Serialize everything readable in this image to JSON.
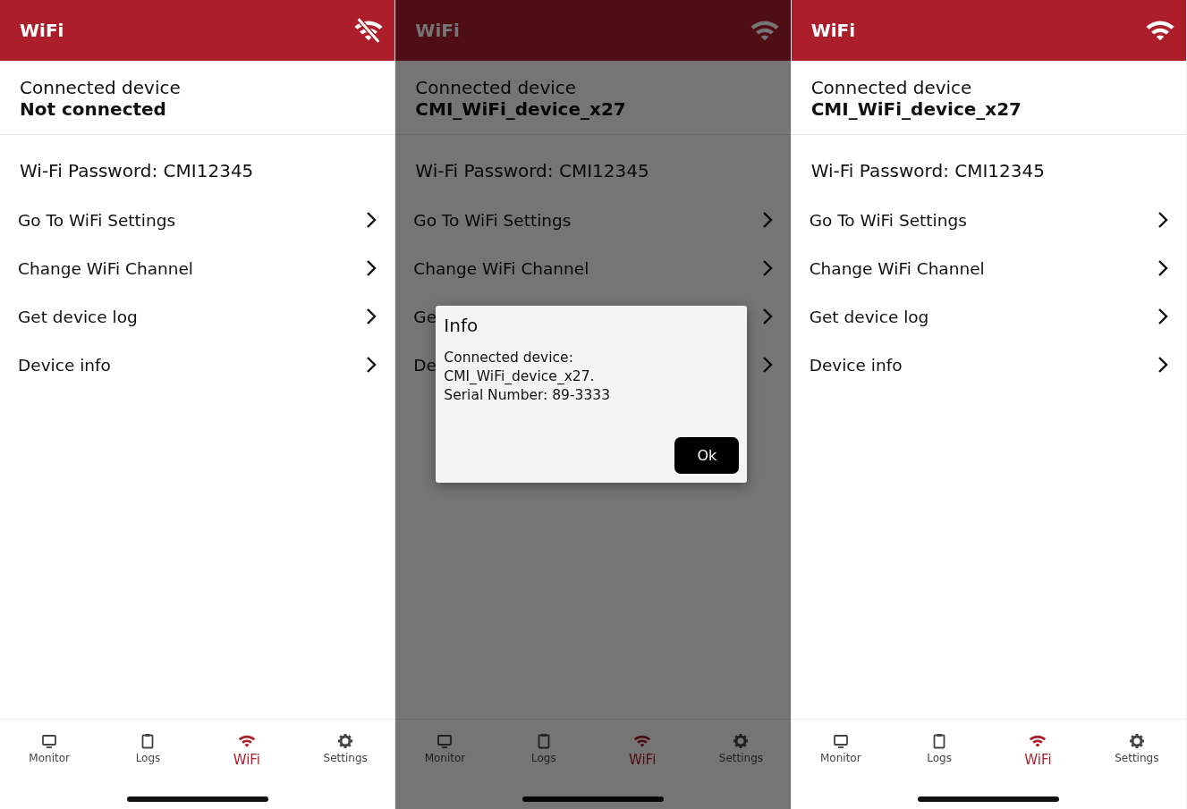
{
  "screens": [
    {
      "title": "WiFi",
      "wifi_connected": false,
      "dimmed": false,
      "connected_label": "Connected device",
      "connected_value": "Not connected",
      "password": "Wi-Fi Password: CMI12345",
      "items": [
        "Go To WiFi Settings",
        "Change WiFi Channel",
        "Get device log",
        "Device info"
      ],
      "tabs": [
        {
          "label": "Monitor",
          "selected": false
        },
        {
          "label": "Logs",
          "selected": false
        },
        {
          "label": "WiFi",
          "selected": true
        },
        {
          "label": "Settings",
          "selected": false
        }
      ]
    },
    {
      "title": "WiFi",
      "wifi_connected": true,
      "dimmed": true,
      "connected_label": "Connected device",
      "connected_value": "CMI_WiFi_device_x27",
      "password": "Wi-Fi Password: CMI12345",
      "items": [
        "Go To WiFi Settings",
        "Change WiFi Channel",
        "Ge",
        "De"
      ],
      "tabs": [
        {
          "label": "Monitor",
          "selected": false
        },
        {
          "label": "Logs",
          "selected": false
        },
        {
          "label": "WiFi",
          "selected": true
        },
        {
          "label": "Settings",
          "selected": false
        }
      ],
      "dialog": {
        "title": "Info",
        "lines": [
          "Connected device:",
          "CMI_WiFi_device_x27.",
          "Serial Number: 89-3333"
        ],
        "button": "Ok"
      }
    },
    {
      "title": "WiFi",
      "wifi_connected": true,
      "dimmed": false,
      "connected_label": "Connected device",
      "connected_value": "CMI_WiFi_device_x27",
      "password": "Wi-Fi Password: CMI12345",
      "items": [
        "Go To WiFi Settings",
        "Change WiFi Channel",
        "Get device log",
        "Device info"
      ],
      "tabs": [
        {
          "label": "Monitor",
          "selected": false
        },
        {
          "label": "Logs",
          "selected": false
        },
        {
          "label": "WiFi",
          "selected": true
        },
        {
          "label": "Settings",
          "selected": false
        }
      ]
    }
  ]
}
